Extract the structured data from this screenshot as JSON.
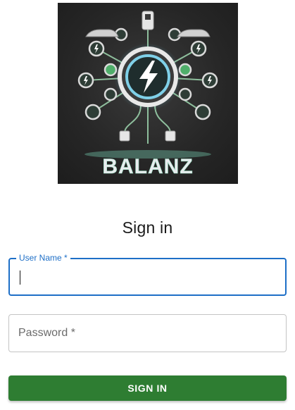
{
  "logo": {
    "brand_text": "BALANZ",
    "icon": "ev-charging-hub-logo"
  },
  "form": {
    "title": "Sign in",
    "username": {
      "label": "User Name *",
      "value": ""
    },
    "password": {
      "placeholder": "Password *",
      "value": ""
    },
    "submit_label": "SIGN IN"
  },
  "colors": {
    "focus_blue": "#1e6fc7",
    "button_green": "#2e7d32",
    "border_gray": "#c4c4c4"
  }
}
